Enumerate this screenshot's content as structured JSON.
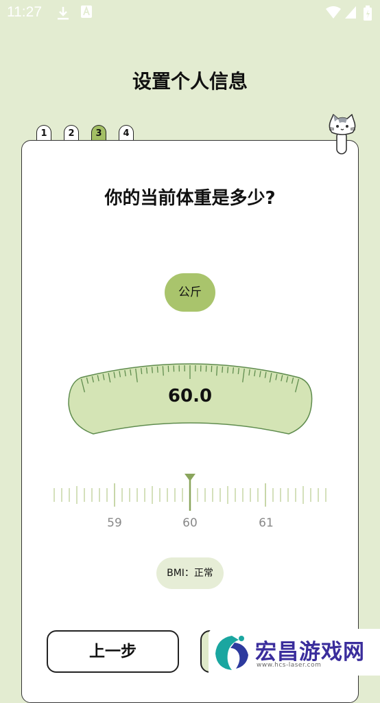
{
  "status_bar": {
    "time": "11:27",
    "icons": [
      "download-icon",
      "font-a-icon",
      "wifi-icon",
      "signal-icon",
      "battery-icon"
    ]
  },
  "header": {
    "title": "设置个人信息"
  },
  "steps": [
    {
      "label": "1",
      "active": false
    },
    {
      "label": "2",
      "active": false
    },
    {
      "label": "3",
      "active": true
    },
    {
      "label": "4",
      "active": false
    }
  ],
  "mascot": "cat-icon",
  "question": "你的当前体重是多少?",
  "unit": {
    "label": "公斤"
  },
  "weight": {
    "value": "60.0"
  },
  "ruler": {
    "labels": [
      "59",
      "60",
      "61"
    ]
  },
  "bmi": {
    "text": "BMI：正常"
  },
  "buttons": {
    "prev": "上一步",
    "next": ""
  },
  "watermark": {
    "title": "宏昌游戏网",
    "url": "www.hcs-laser.com"
  },
  "colors": {
    "background": "#e3ecd1",
    "accent": "#a9c46c",
    "gauge": "#d4e4b5",
    "dark_green": "#5f8c4e"
  }
}
